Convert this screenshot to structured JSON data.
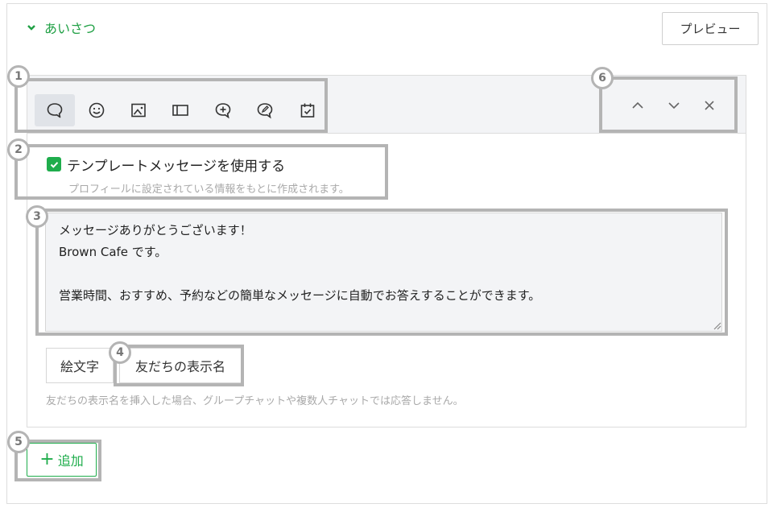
{
  "section": {
    "title": "あいさつ"
  },
  "header": {
    "preview_label": "プレビュー"
  },
  "toolbar": {
    "tools": [
      "speech-bubble-icon",
      "smile-icon",
      "image-icon",
      "card-icon",
      "coupon-icon",
      "research-icon",
      "reservation-icon"
    ],
    "controls": [
      "move-up-icon",
      "move-down-icon",
      "close-icon"
    ]
  },
  "template": {
    "checked": true,
    "label": "テンプレートメッセージを使用する",
    "sublabel": "プロフィールに設定されている情報をもとに作成されます。"
  },
  "message": {
    "line1": "メッセージありがとうございます！",
    "line2": "Brown Cafe です。",
    "line3": "",
    "line4": "営業時間、おすすめ、予約などの簡単なメッセージに自動でお答えすることができます。"
  },
  "buttons": {
    "emoji_label": "絵文字",
    "friend_name_label": "友だちの表示名"
  },
  "hint": "友だちの表示名を挿入した場合、グループチャットや複数人チャットでは応答しません。",
  "add": {
    "label": "追加"
  },
  "callouts": [
    "1",
    "2",
    "3",
    "4",
    "5",
    "6"
  ],
  "colors": {
    "accent": "#1fad4c",
    "callout": "#b4b4b4",
    "panel_bg": "#f3f4f6"
  }
}
